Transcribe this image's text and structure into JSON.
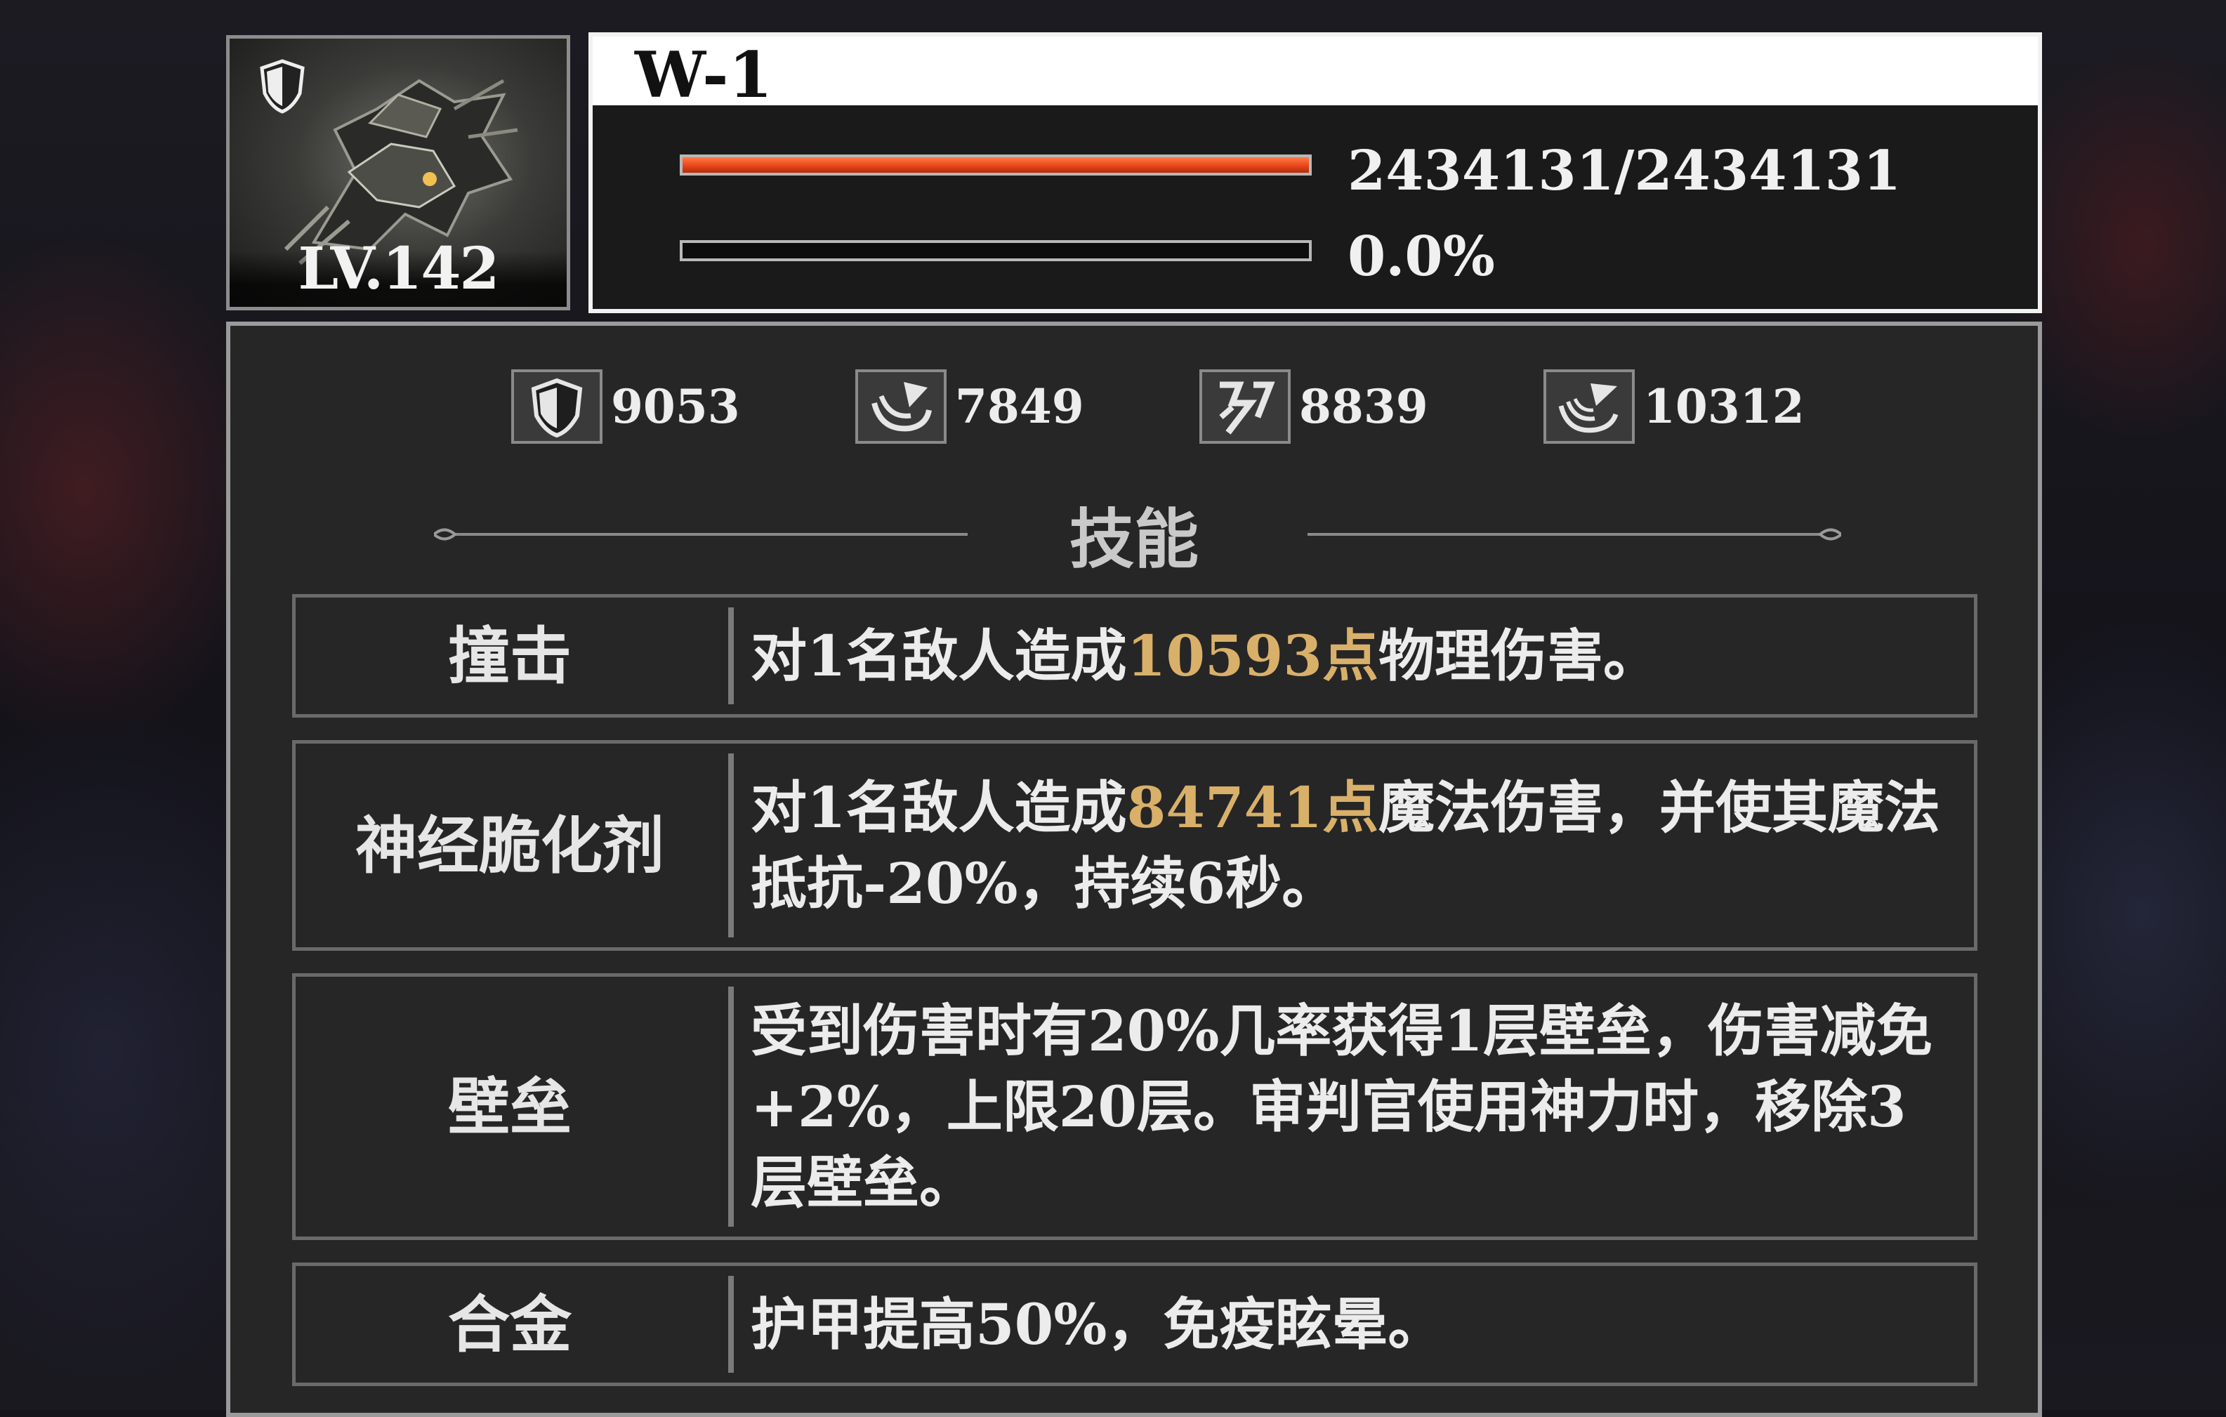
{
  "boss": {
    "name": "W-1",
    "level": "LV.142",
    "hp_text": "2434131/2434131",
    "hp_fraction": 1.0,
    "secondary_text": "0.0%",
    "secondary_fraction": 0.0
  },
  "stats": [
    {
      "icon": "armor-shield-icon",
      "value": "9053"
    },
    {
      "icon": "magic-resist-icon",
      "value": "7849"
    },
    {
      "icon": "slash-resist-icon",
      "value": "8839"
    },
    {
      "icon": "spirit-resist-icon",
      "value": "10312"
    }
  ],
  "section_title": "技能",
  "skills": [
    {
      "name": "撞击",
      "desc_before": "对1名敌人造成",
      "desc_highlight": "10593点",
      "desc_after": "物理伤害。"
    },
    {
      "name": "神经脆化剂",
      "desc_before": "对1名敌人造成",
      "desc_highlight": "84741点",
      "desc_after": "魔法伤害，并使其魔法抵抗-20%，持续6秒。"
    },
    {
      "name": "壁垒",
      "desc_before": "受到伤害时有20%几率获得1层壁垒，伤害减免+2%，上限20层。审判官使用神力时，移除3层壁垒。",
      "desc_highlight": "",
      "desc_after": ""
    },
    {
      "name": "合金",
      "desc_before": "护甲提高50%，免疫眩晕。",
      "desc_highlight": "",
      "desc_after": ""
    }
  ],
  "colors": {
    "highlight": "#d9b06a",
    "hp_bar": "#ee4a1c"
  }
}
